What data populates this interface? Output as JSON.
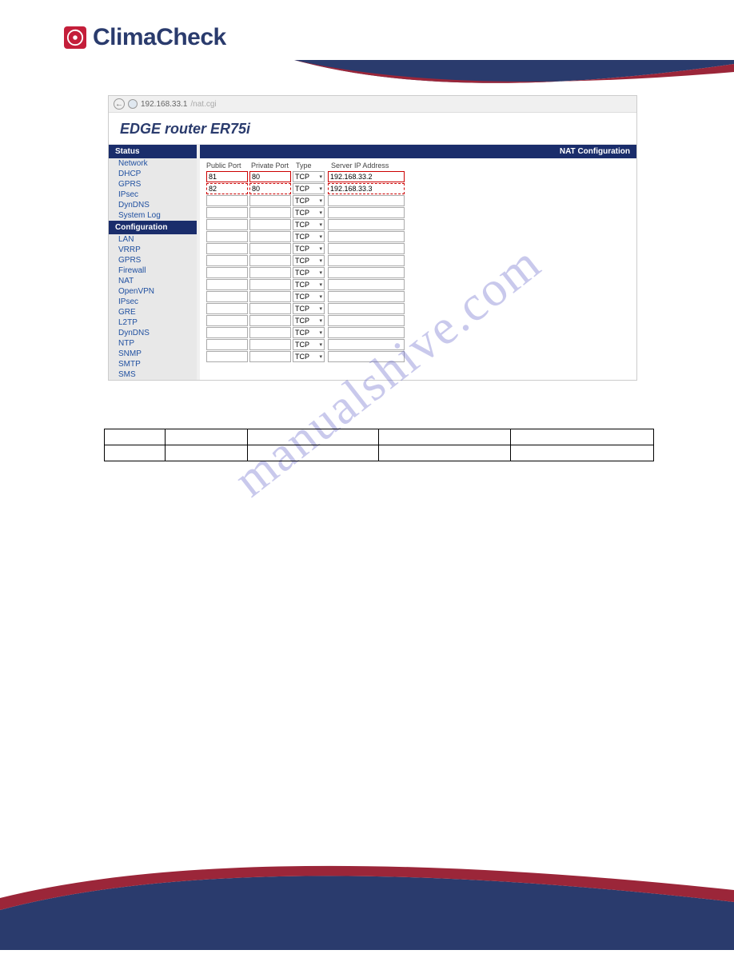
{
  "brand": {
    "name": "ClimaCheck"
  },
  "watermark": "manualshive.com",
  "addressbar": {
    "url": "192.168.33.1",
    "path": "/nat.cgi"
  },
  "router": {
    "title": "EDGE router ER75i",
    "sidebar": {
      "status_hdr": "Status",
      "status_items": [
        "Network",
        "DHCP",
        "GPRS",
        "IPsec",
        "DynDNS",
        "System Log"
      ],
      "config_hdr": "Configuration",
      "config_items": [
        "LAN",
        "VRRP",
        "GPRS",
        "Firewall",
        "NAT",
        "OpenVPN",
        "IPsec",
        "GRE",
        "L2TP",
        "DynDNS",
        "NTP",
        "SNMP",
        "SMTP",
        "SMS"
      ]
    },
    "main": {
      "title": "NAT Configuration",
      "columns": {
        "pub": "Public Port",
        "priv": "Private Port",
        "type": "Type",
        "ip": "Server IP Address"
      },
      "type_default": "TCP",
      "rows": [
        {
          "pub": "81",
          "priv": "80",
          "type": "TCP",
          "ip": "192.168.33.2",
          "hl": "solid"
        },
        {
          "pub": "82",
          "priv": "80",
          "type": "TCP",
          "ip": "192.168.33.3",
          "hl": "dash"
        }
      ],
      "empty_rows": 14
    }
  }
}
